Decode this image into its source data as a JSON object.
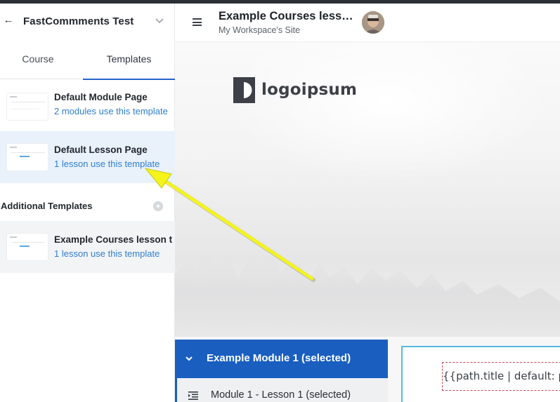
{
  "sidebar": {
    "site_title": "FastCommments Test",
    "tabs": [
      {
        "label": "Course"
      },
      {
        "label": "Templates"
      }
    ],
    "templates": [
      {
        "name": "Default Module Page",
        "usage": "2 modules use this template"
      },
      {
        "name": "Default Lesson Page",
        "usage": "1 lesson use this template"
      }
    ],
    "additional_title": "Additional Templates",
    "additional": [
      {
        "name": "Example Courses lesson t",
        "usage": "1 lesson use this template"
      }
    ]
  },
  "header": {
    "title": "Example Courses less…",
    "subtitle": "My Workspace's Site"
  },
  "main": {
    "logo_text": "logoipsum",
    "module_title": "Example Module 1 (selected)",
    "lesson_label": "Module 1 - Lesson 1 (selected)",
    "template_code": "{{path.title | default: pa"
  },
  "colors": {
    "accent": "#1a5fc0",
    "link": "#2f7fd0",
    "selected_row": "#e9f1fb",
    "annotation_arrow": "#f4f41c"
  }
}
